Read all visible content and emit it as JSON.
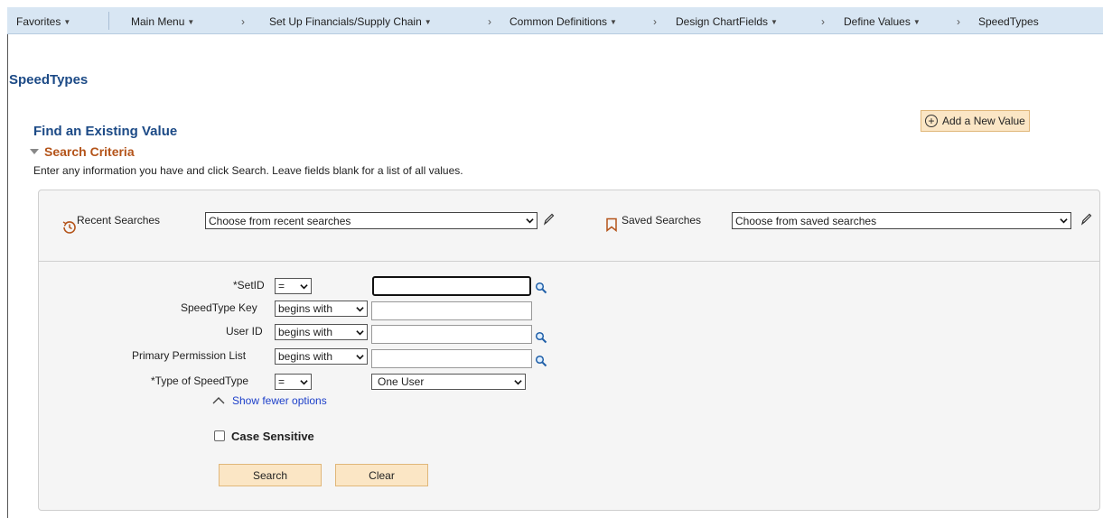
{
  "nav": {
    "favorites": "Favorites",
    "main_menu": "Main Menu",
    "breadcrumbs": [
      "Set Up Financials/Supply Chain",
      "Common Definitions",
      "Design ChartFields",
      "Define Values",
      "SpeedTypes"
    ]
  },
  "page": {
    "title": "SpeedTypes",
    "find_title": "Find an Existing Value",
    "add_new": "Add a New Value",
    "search_criteria": "Search Criteria",
    "instructions": "Enter any information you have and click Search. Leave fields blank for a list of all values."
  },
  "searches": {
    "recent_label": "Recent Searches",
    "recent_placeholder": "Choose from recent searches",
    "saved_label": "Saved Searches",
    "saved_placeholder": "Choose from saved searches"
  },
  "fields": {
    "setid": {
      "label": "*SetID",
      "operator": "=",
      "value": ""
    },
    "speedtype_key": {
      "label": "SpeedType Key",
      "operator": "begins with",
      "value": ""
    },
    "user_id": {
      "label": "User ID",
      "operator": "begins with",
      "value": ""
    },
    "primary_permission_list": {
      "label": "Primary Permission List",
      "operator": "begins with",
      "value": ""
    },
    "type_of_speedtype": {
      "label": "*Type of SpeedType",
      "operator": "=",
      "value": "One User"
    }
  },
  "options": {
    "show_fewer": "Show fewer options",
    "case_sensitive": "Case Sensitive",
    "case_sensitive_checked": false
  },
  "buttons": {
    "search": "Search",
    "clear": "Clear"
  },
  "colors": {
    "title": "#1c4a86",
    "criteria": "#b4541a",
    "button_bg": "#fbe6c5",
    "nav_bg": "#d8e6f3",
    "link": "#1c3fc9"
  },
  "icons": [
    "chevron-down-icon",
    "chevron-right-icon",
    "plus-circle-icon",
    "triangle-down-icon",
    "clock-history-icon",
    "bookmark-icon",
    "pencil-icon",
    "lookup-magnifier-icon",
    "chevron-up-icon"
  ]
}
